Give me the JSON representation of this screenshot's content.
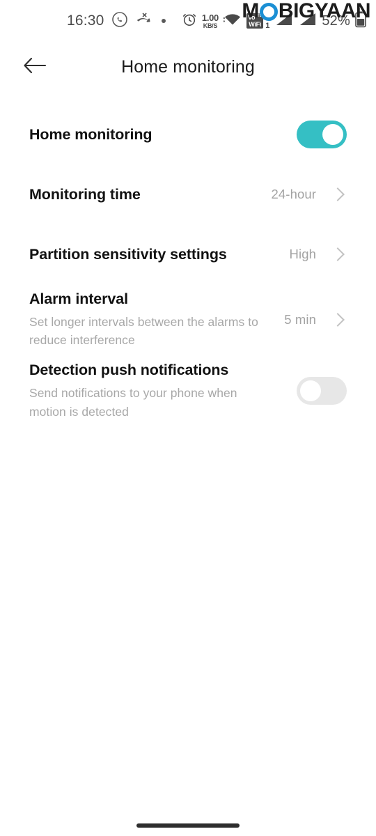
{
  "status_bar": {
    "time": "16:30",
    "icons_left": [
      "whatsapp-icon",
      "missed-call-icon",
      "dot-indicator"
    ],
    "alarm_icon": "alarm-icon",
    "network_speed_value": "1.00",
    "network_speed_unit": "KB/S",
    "wifi_icon": "wifi-icon",
    "vowifi_line1": "Vo",
    "vowifi_sup": "LTE",
    "vowifi_line2": "WiFi",
    "sim_indicator": "1",
    "signal_icons": [
      "signal-bars-sim1",
      "signal-bars-sim2"
    ],
    "battery_percent": "52%",
    "battery_icon": "battery-icon"
  },
  "watermark": {
    "prefix": "M",
    "suffix": "BIGYAAN",
    "circle_color": "#1b8fd4"
  },
  "app_bar": {
    "back_icon": "back-arrow-icon",
    "title": "Home monitoring"
  },
  "accent_color": "#35bfc4",
  "settings": {
    "rows": [
      {
        "title": "Home monitoring",
        "subtitle": "",
        "value": "",
        "control": "toggle",
        "toggle_state": "on"
      },
      {
        "title": "Monitoring time",
        "subtitle": "",
        "value": "24-hour",
        "control": "chevron",
        "toggle_state": ""
      },
      {
        "title": "Partition sensitivity settings",
        "subtitle": "",
        "value": "High",
        "control": "chevron",
        "toggle_state": ""
      },
      {
        "title": "Alarm interval",
        "subtitle": "Set longer intervals between the alarms to reduce interference",
        "value": "5 min",
        "control": "chevron",
        "toggle_state": ""
      },
      {
        "title": "Detection push notifications",
        "subtitle": "Send notifications to your phone when motion is detected",
        "value": "",
        "control": "toggle",
        "toggle_state": "off"
      }
    ]
  },
  "nav": {
    "home_indicator": "home-indicator"
  }
}
